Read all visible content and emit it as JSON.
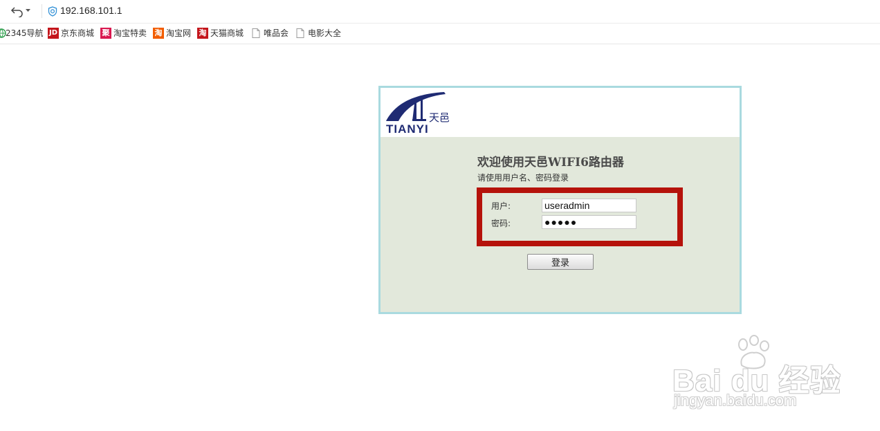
{
  "browser": {
    "url": "192.168.101.1",
    "bookmarks": [
      {
        "label": "2345导航",
        "icon": "globe-icon"
      },
      {
        "label": "京东商城",
        "icon": "jd-icon",
        "badge": "JD",
        "color": "#c4161c"
      },
      {
        "label": "淘宝特卖",
        "icon": "ju-icon",
        "badge": "聚",
        "color": "#d9184f"
      },
      {
        "label": "淘宝网",
        "icon": "taobao-icon",
        "badge": "淘",
        "color": "#f25d00"
      },
      {
        "label": "天猫商城",
        "icon": "tmall-icon",
        "badge": "淘",
        "color": "#c4161c"
      },
      {
        "label": "唯品会",
        "icon": "page-icon"
      },
      {
        "label": "电影大全",
        "icon": "page-icon"
      }
    ]
  },
  "login": {
    "logo_cn": "天邑",
    "logo_en": "TIANYI",
    "title": "欢迎使用天邑WIFI6路由器",
    "subtitle": "请使用用户名、密码登录",
    "username_label": "用户:",
    "username_value": "useradmin",
    "password_label": "密码:",
    "password_value": "●●●●●",
    "submit_label": "登录"
  },
  "watermark": {
    "brand": "Bai  du 经验",
    "url": "jingyan.baidu.com"
  },
  "colors": {
    "frame_border": "#a9dadf",
    "panel_bg": "#e2e8db",
    "highlight": "#b5120b",
    "logo_blue": "#1f2b73"
  }
}
